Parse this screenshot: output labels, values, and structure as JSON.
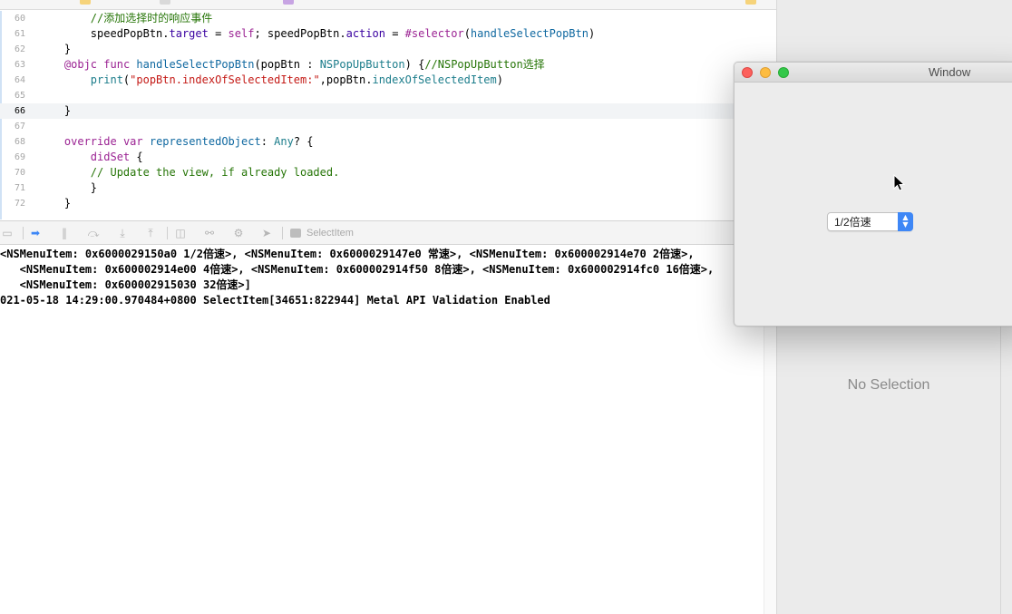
{
  "editor": {
    "lines": [
      {
        "num": "60",
        "tokens": [
          [
            "cm",
            "//添加选择时的响应事件"
          ]
        ],
        "indent": "        "
      },
      {
        "num": "61",
        "tokens": [
          [
            "",
            "speedPopBtn."
          ],
          [
            "ky",
            "target"
          ],
          [
            "",
            " = "
          ],
          [
            "kw",
            "self"
          ],
          [
            "",
            "; speedPopBtn."
          ],
          [
            "ky",
            "action"
          ],
          [
            "",
            " = "
          ],
          [
            "kw",
            "#selector"
          ],
          [
            "",
            "("
          ],
          [
            "fn",
            "handleSelectPopBtn"
          ],
          [
            "",
            ")"
          ]
        ],
        "indent": "        "
      },
      {
        "num": "62",
        "tokens": [
          [
            "",
            "}"
          ]
        ],
        "indent": "    "
      },
      {
        "num": "63",
        "tokens": [
          [
            "kw",
            "@objc"
          ],
          [
            "",
            " "
          ],
          [
            "kw",
            "func"
          ],
          [
            "",
            " "
          ],
          [
            "fn",
            "handleSelectPopBtn"
          ],
          [
            "",
            "(popBtn : "
          ],
          [
            "ty",
            "NSPopUpButton"
          ],
          [
            "",
            ") {"
          ],
          [
            "cm",
            "//NSPopUpButton选择"
          ]
        ],
        "indent": "    "
      },
      {
        "num": "64",
        "tokens": [
          [
            "ty",
            "print"
          ],
          [
            "",
            "("
          ],
          [
            "str",
            "\"popBtn.indexOfSelectedItem:\""
          ],
          [
            "",
            ",popBtn."
          ],
          [
            "ty",
            "indexOfSelectedItem"
          ],
          [
            "",
            ")"
          ]
        ],
        "indent": "        "
      },
      {
        "num": "65",
        "tokens": [],
        "indent": ""
      },
      {
        "num": "66",
        "tokens": [
          [
            "",
            "}"
          ]
        ],
        "indent": "    ",
        "current": true
      },
      {
        "num": "67",
        "tokens": [],
        "indent": ""
      },
      {
        "num": "68",
        "tokens": [
          [
            "kw",
            "override"
          ],
          [
            "",
            " "
          ],
          [
            "kw",
            "var"
          ],
          [
            "",
            " "
          ],
          [
            "fn",
            "representedObject"
          ],
          [
            "",
            ": "
          ],
          [
            "ty",
            "Any"
          ],
          [
            "",
            "? {"
          ]
        ],
        "indent": "    "
      },
      {
        "num": "69",
        "tokens": [
          [
            "kw",
            "didSet"
          ],
          [
            "",
            " {"
          ]
        ],
        "indent": "        "
      },
      {
        "num": "70",
        "tokens": [
          [
            "cm",
            "// Update the view, if already loaded."
          ]
        ],
        "indent": "        "
      },
      {
        "num": "71",
        "tokens": [
          [
            "",
            "}"
          ]
        ],
        "indent": "        "
      },
      {
        "num": "72",
        "tokens": [
          [
            "",
            "}"
          ]
        ],
        "indent": "    "
      }
    ]
  },
  "debugbar": {
    "target_label": "SelectItem",
    "buttons": [
      "hide-debug-area-icon",
      "breakpoints-toggle-icon",
      "pause-icon",
      "step-over-icon",
      "step-into-icon",
      "step-out-icon",
      "view-hierarchy-icon",
      "memory-graph-icon",
      "environment-overrides-icon",
      "simulate-location-icon"
    ]
  },
  "console": {
    "lines": [
      "<NSMenuItem: 0x6000029150a0 1/2倍速>, <NSMenuItem: 0x6000029147e0 常速>, <NSMenuItem: 0x600002914e70 2倍速>,",
      "   <NSMenuItem: 0x600002914e00 4倍速>, <NSMenuItem: 0x600002914f50 8倍速>, <NSMenuItem: 0x600002914fc0 16倍速>,",
      "   <NSMenuItem: 0x600002915030 32倍速>]",
      "021-05-18 14:29:00.970484+0800 SelectItem[34651:822944] Metal API Validation Enabled"
    ]
  },
  "inspector": {
    "no_selection": "No Selection"
  },
  "window": {
    "title": "Window",
    "popup": {
      "selected": "1/2倍速"
    }
  },
  "colors": {
    "keyword": "#9b2393",
    "comment": "#267507",
    "string": "#c41a16",
    "type": "#1c7d8b",
    "accent": "#3e87f6"
  }
}
